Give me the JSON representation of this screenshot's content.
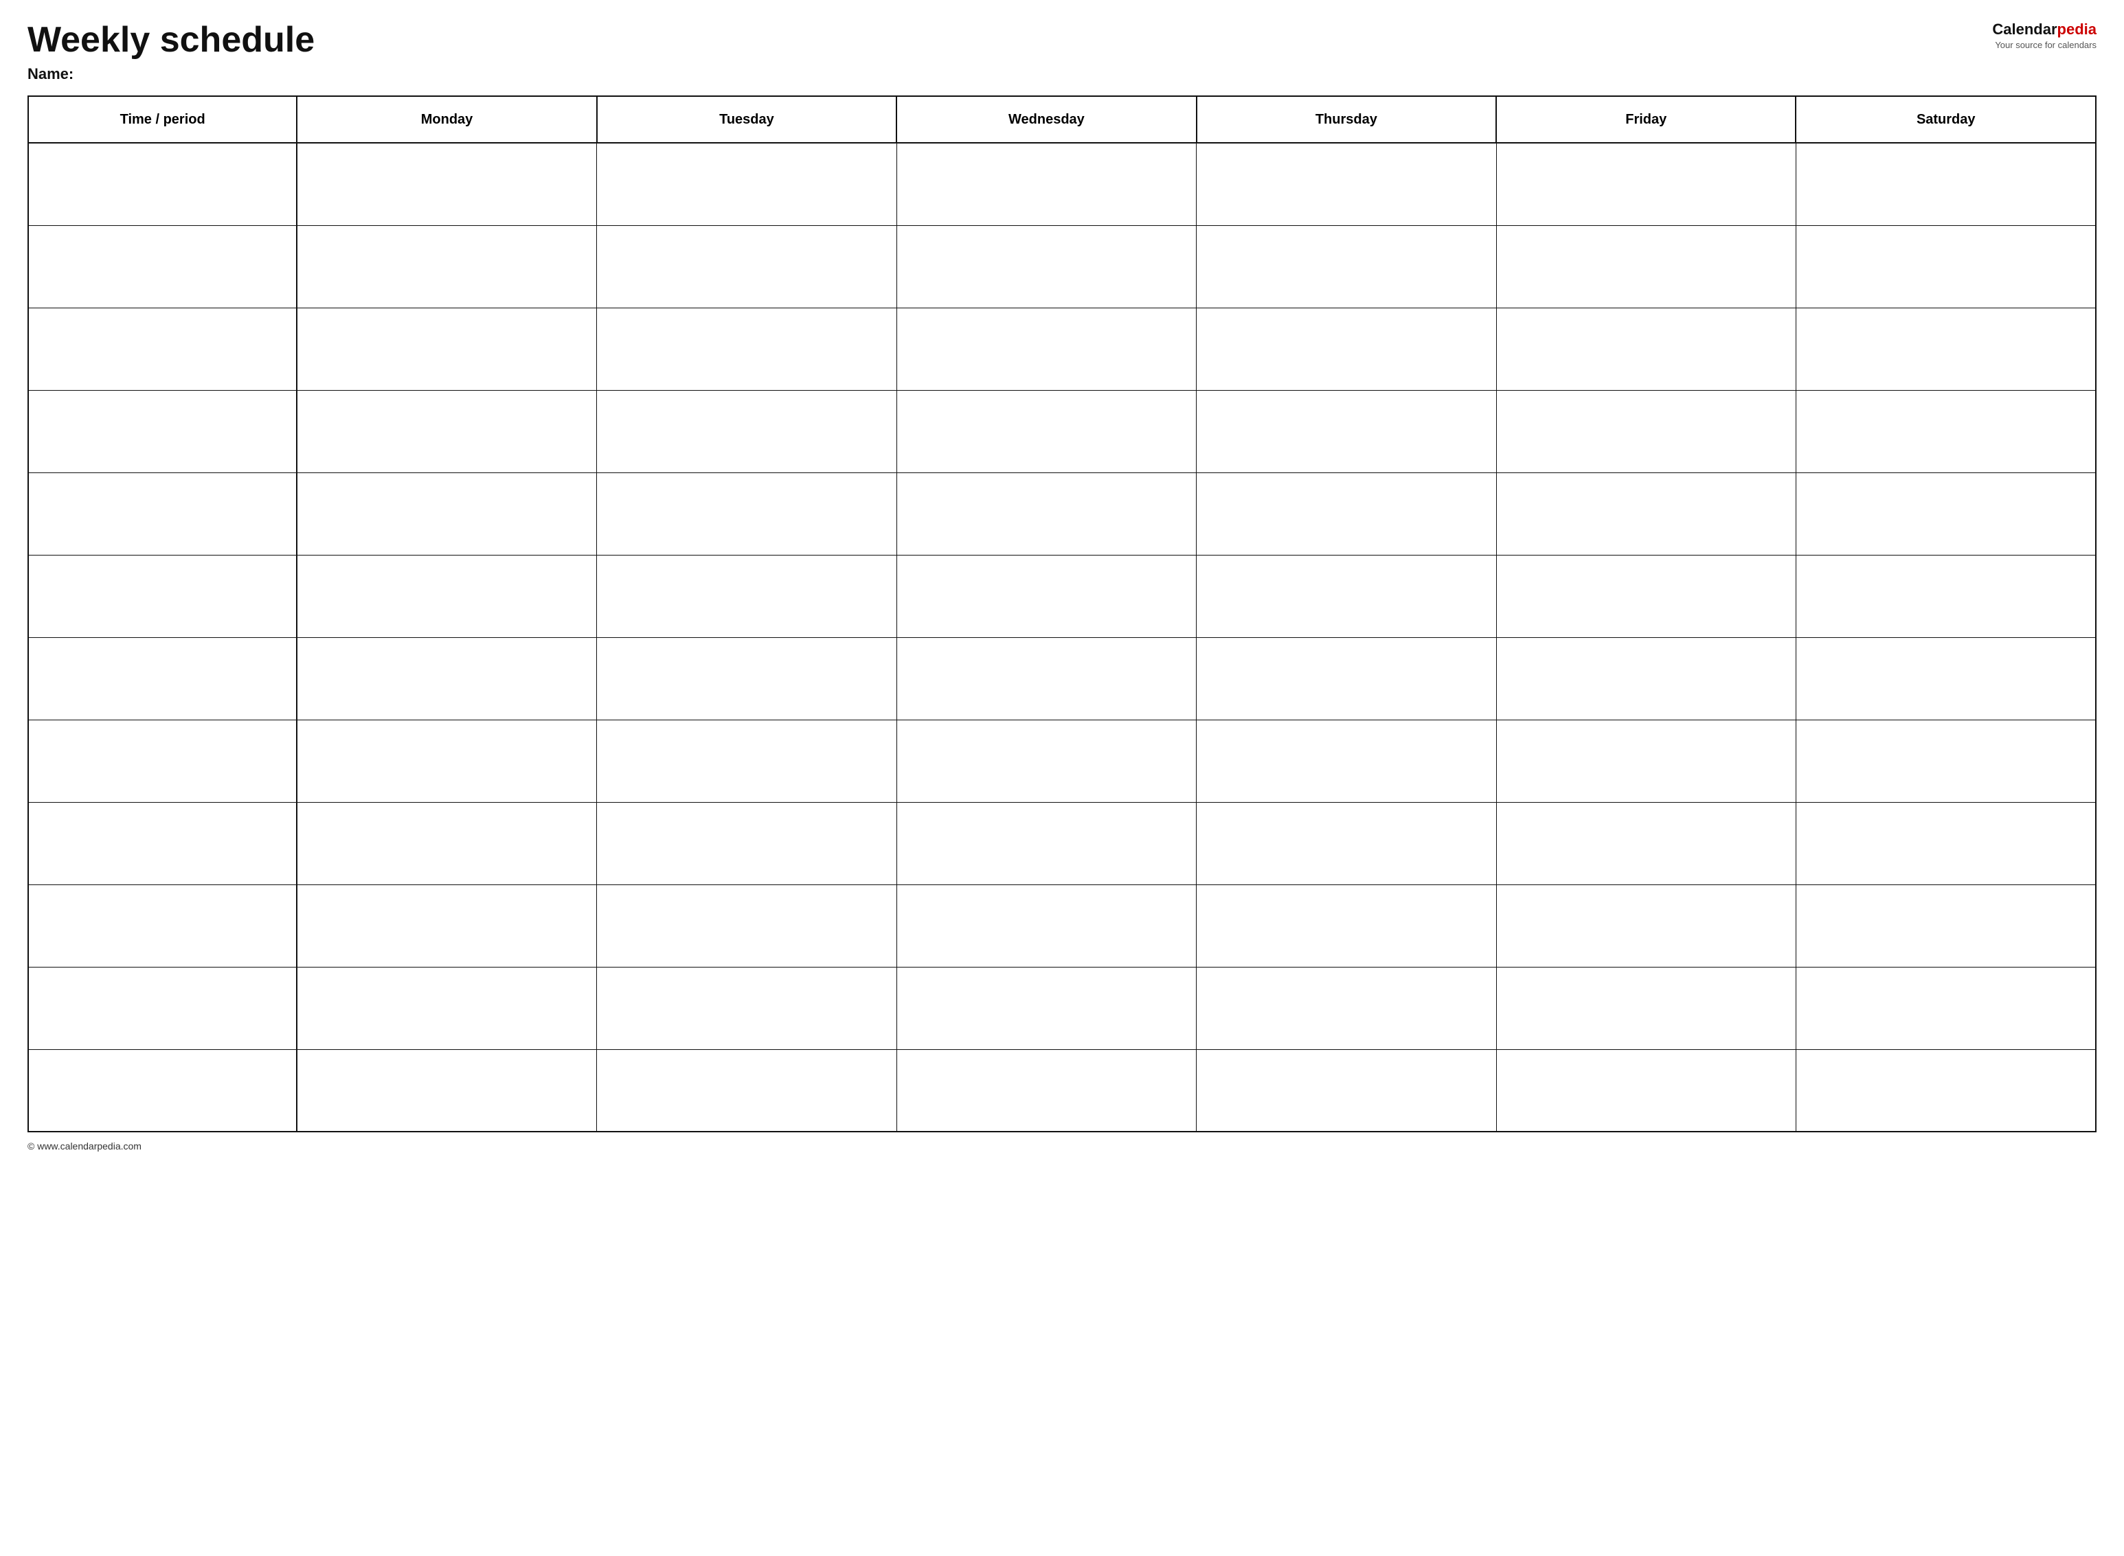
{
  "header": {
    "title": "Weekly schedule",
    "name_label": "Name:",
    "logo": {
      "brand_part1": "Calendar",
      "brand_part2": "pedia",
      "tagline": "Your source for calendars"
    }
  },
  "table": {
    "columns": [
      "Time / period",
      "Monday",
      "Tuesday",
      "Wednesday",
      "Thursday",
      "Friday",
      "Saturday"
    ],
    "row_count": 12
  },
  "footer": {
    "url": "© www.calendarpedia.com"
  }
}
